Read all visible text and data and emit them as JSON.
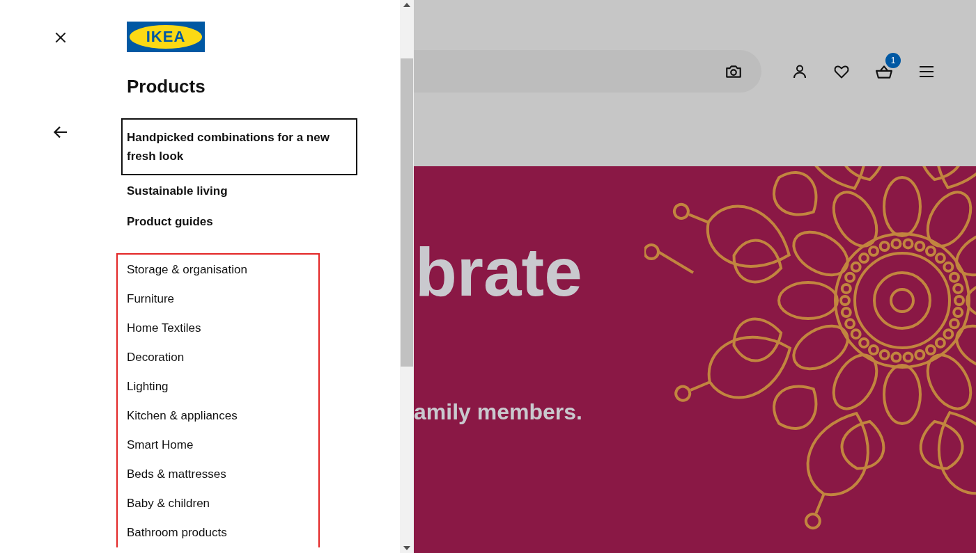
{
  "menu_panel": {
    "logo": {
      "text": "IKEA"
    },
    "heading": "Products",
    "featured_links": [
      {
        "label": "Handpicked combinations for a new fresh look",
        "focused": true
      },
      {
        "label": "Sustainable living",
        "focused": false
      },
      {
        "label": "Product guides",
        "focused": false
      }
    ],
    "categories": [
      "Storage & organisation",
      "Furniture",
      "Home Textiles",
      "Decoration",
      "Lighting",
      "Kitchen & appliances",
      "Smart Home",
      "Beds & mattresses",
      "Baby & children",
      "Bathroom products"
    ]
  },
  "header": {
    "cart_count": "1"
  },
  "banner": {
    "headline": "brate",
    "subline": "amily members."
  }
}
